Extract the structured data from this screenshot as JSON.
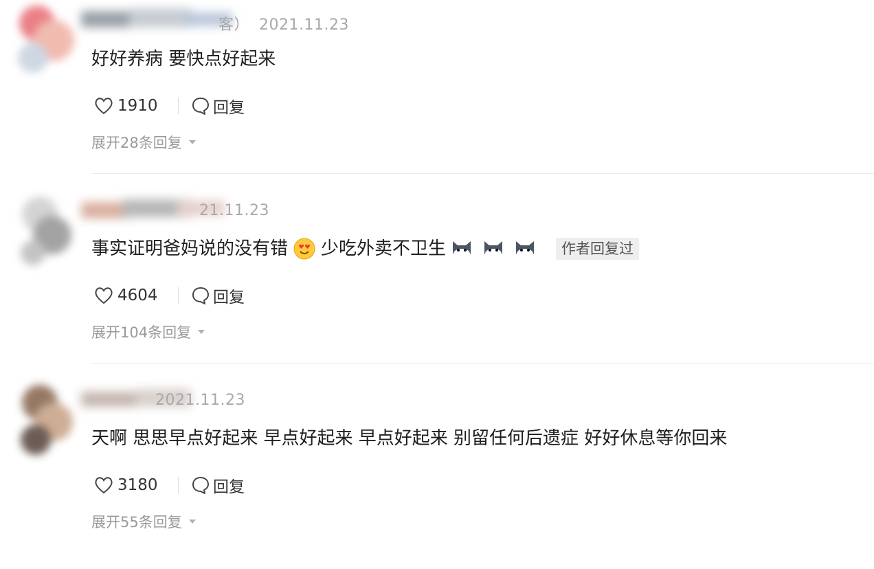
{
  "comments": [
    {
      "meta_suffix": "客）",
      "date": "2021.11.23",
      "text": "好好养病 要快点好起来",
      "likes": "1910",
      "reply_label": "回复",
      "expand_label": "展开28条回复",
      "avatar_colors": [
        "#e8737a",
        "#f0b4a8",
        "#c9d3e0"
      ]
    },
    {
      "meta_suffix": "",
      "date": "21.11.23",
      "text_before": "事实证明爸妈说的没有错",
      "text_after": "少吃外卖不卫生",
      "emojis": [
        "heart-eyes-emoji-icon",
        "cat-emoji-icon",
        "cat-emoji-icon",
        "cat-emoji-icon"
      ],
      "badge": "作者回复过",
      "likes": "4604",
      "reply_label": "回复",
      "expand_label": "展开104条回复",
      "avatar_colors": [
        "#c8c8c8",
        "#9a9a9a",
        "#d9b0a0"
      ]
    },
    {
      "meta_suffix": "",
      "date": "2021.11.23",
      "text": "天啊 思思早点好起来 早点好起来 早点好起来 别留任何后遗症 好好休息等你回来",
      "likes": "3180",
      "reply_label": "回复",
      "expand_label": "展开55条回复",
      "avatar_colors": [
        "#8a6a52",
        "#c9a58a",
        "#5b4a42"
      ]
    }
  ],
  "colors": {
    "meta_gray": "#a8a8a8",
    "expand_gray": "#9a9a9a",
    "badge_bg": "#eeeeee"
  }
}
